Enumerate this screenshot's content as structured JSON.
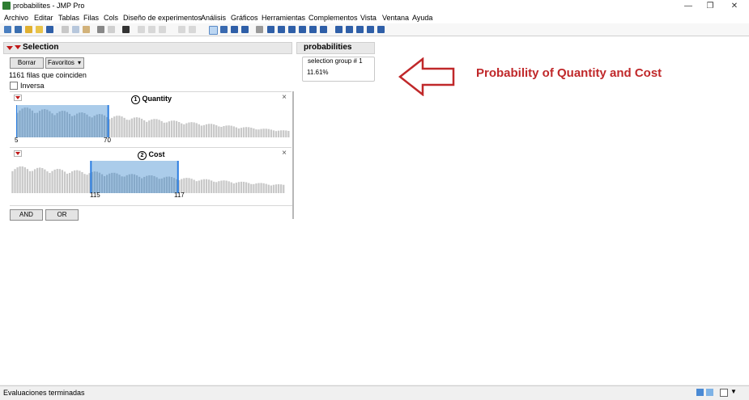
{
  "window": {
    "title": "probabilites - JMP Pro",
    "minimize": "—",
    "restore": "❐",
    "close": "✕"
  },
  "menu": [
    "Archivo",
    "Editar",
    "Tablas",
    "Filas",
    "Cols",
    "Diseño de experimentos",
    "Análisis",
    "Gráficos",
    "Herramientas",
    "Complementos",
    "Vista",
    "Ventana",
    "Ayuda"
  ],
  "selection": {
    "title": "Selection",
    "clear_label": "Borrar",
    "favorites_label": "Favoritos",
    "favorites_arrow": "▾",
    "rows_matched": "1161 filas que coinciden",
    "inverse_label": "Inversa",
    "filters": [
      {
        "title": "Quantity",
        "number": "1",
        "low": "5",
        "high": "70"
      },
      {
        "title": "Cost",
        "number": "2",
        "low": "115",
        "high": "117"
      }
    ],
    "and_label": "AND",
    "or_label": "OR"
  },
  "probabilities": {
    "title": "probabilities",
    "group_label": "selection group # 1",
    "value": "11.61%"
  },
  "annotation": {
    "text": "Probability of Quantity and Cost",
    "color": "#c0282a"
  },
  "status": {
    "text": "Evaluaciones terminadas"
  },
  "colors": {
    "accent": "#2a7de1",
    "selected_fill": "#9cc3e6",
    "bar": "#c8c8c8"
  }
}
